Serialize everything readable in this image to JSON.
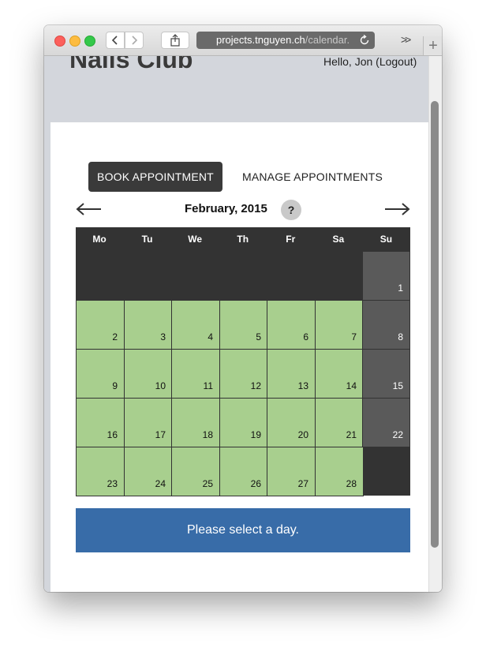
{
  "browser": {
    "url_host": "projects.tnguyen.ch",
    "url_path": "/calendar.",
    "overflow_label": ">>",
    "new_tab_label": "+"
  },
  "site": {
    "title": "Nails Club",
    "greeting": "Hello, ",
    "user": "Jon",
    "logout": "(Logout)"
  },
  "tabs": {
    "book": "Book Appointment",
    "manage": "Manage Appointments"
  },
  "calendar": {
    "month_label": "February, 2015",
    "help_label": "?",
    "weekdays": [
      "Mo",
      "Tu",
      "We",
      "Th",
      "Fr",
      "Sa",
      "Su"
    ],
    "weeks": [
      [
        "",
        "",
        "",
        "",
        "",
        "",
        "1"
      ],
      [
        "2",
        "3",
        "4",
        "5",
        "6",
        "7",
        "8"
      ],
      [
        "9",
        "10",
        "11",
        "12",
        "13",
        "14",
        "15"
      ],
      [
        "16",
        "17",
        "18",
        "19",
        "20",
        "21",
        "22"
      ],
      [
        "23",
        "24",
        "25",
        "26",
        "27",
        "28",
        ""
      ]
    ]
  },
  "notice": "Please select a day.",
  "colors": {
    "available_day": "#a8cf8e",
    "weekend_day": "#5a5a5a",
    "calendar_bg": "#333333",
    "notice_bg": "#386ca8",
    "active_tab": "#3a3a3a"
  }
}
